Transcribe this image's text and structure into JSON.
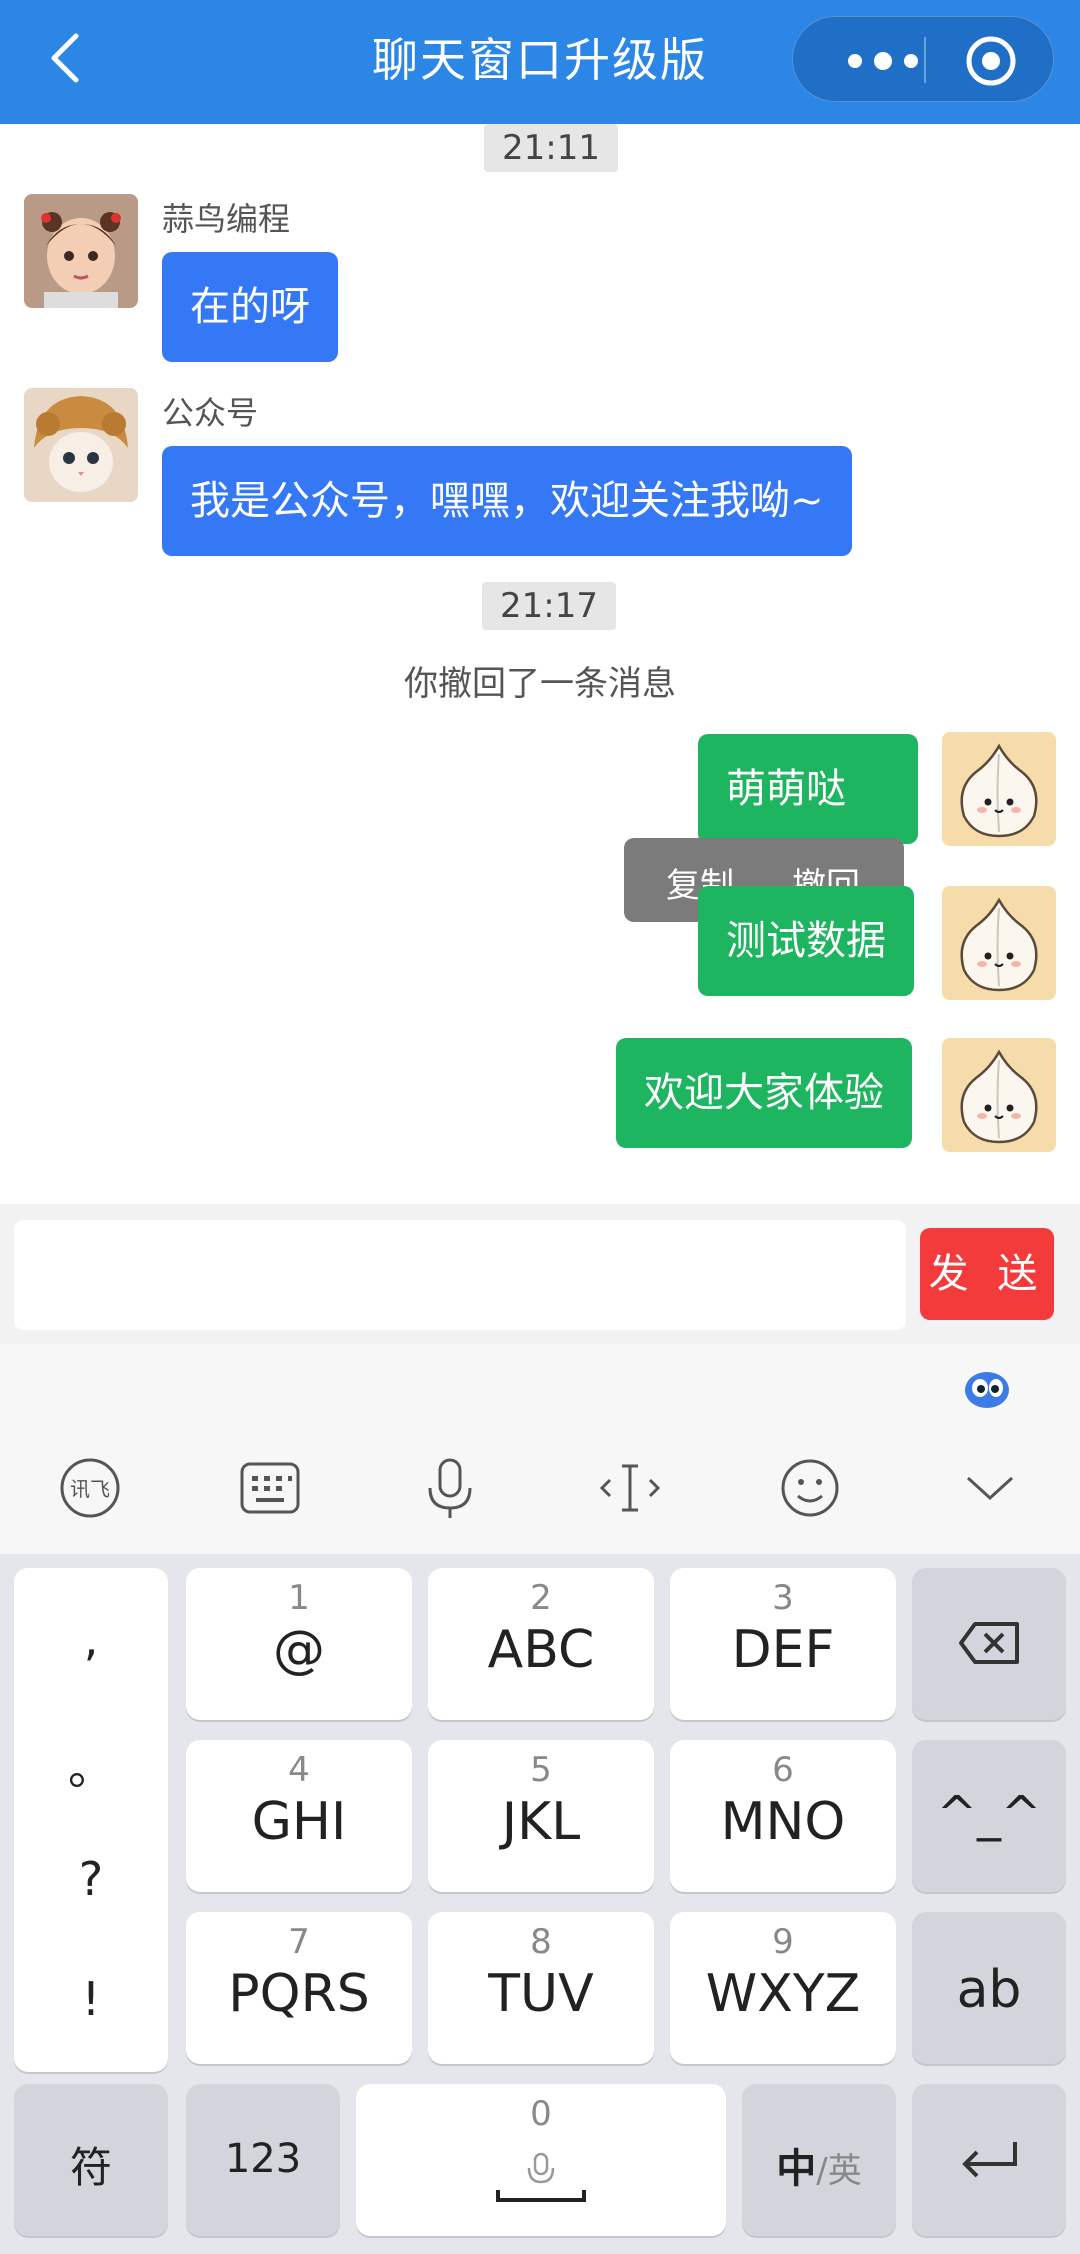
{
  "header": {
    "title": "聊天窗口升级版"
  },
  "chat": {
    "time1": "21:11",
    "msg1": {
      "nick": "蒜鸟编程",
      "text": "在的呀"
    },
    "msg2": {
      "nick": "公众号",
      "text": "我是公众号，嘿嘿，欢迎关注我呦~"
    },
    "time2": "21:17",
    "recall_notice": "你撤回了一条消息",
    "popup": {
      "copy": "复制",
      "recall": "撤回"
    },
    "my_msg1_hidden": "萌萌哒",
    "my_msg2": "测试数据",
    "my_msg3": "欢迎大家体验"
  },
  "input": {
    "value": "",
    "send_label": "发 送"
  },
  "keyboard": {
    "punct": [
      ",",
      "。",
      "?",
      "!"
    ],
    "keys": [
      {
        "num": "1",
        "letters": "@"
      },
      {
        "num": "2",
        "letters": "ABC"
      },
      {
        "num": "3",
        "letters": "DEF"
      },
      {
        "num": "4",
        "letters": "GHI"
      },
      {
        "num": "5",
        "letters": "JKL"
      },
      {
        "num": "6",
        "letters": "MNO"
      },
      {
        "num": "7",
        "letters": "PQRS"
      },
      {
        "num": "8",
        "letters": "TUV"
      },
      {
        "num": "9",
        "letters": "WXYZ"
      }
    ],
    "emoticon": "^_^",
    "ab": "ab",
    "fu": "符",
    "num123": "123",
    "zero": "0",
    "lang_main": "中",
    "lang_sep": "/英"
  }
}
